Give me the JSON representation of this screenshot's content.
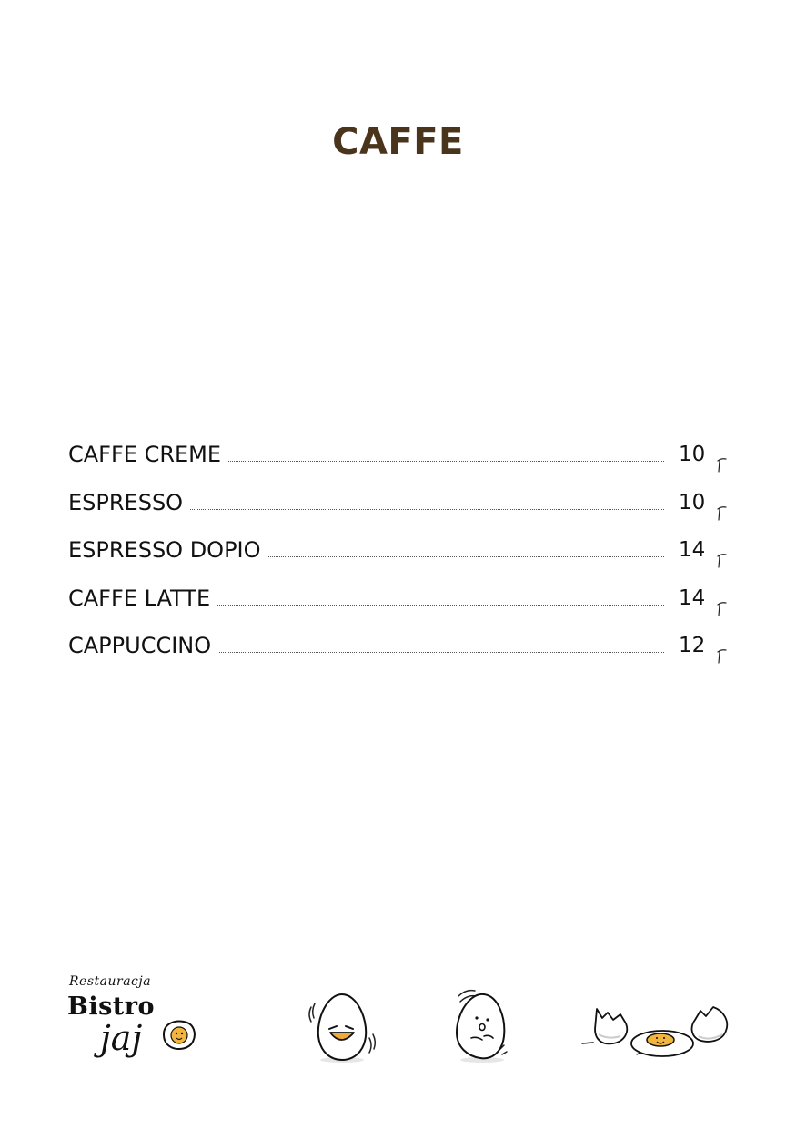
{
  "page": {
    "title": "CAFFE"
  },
  "menu": {
    "items": [
      {
        "name": "CAFFE CREME",
        "price": "10"
      },
      {
        "name": "ESPRESSO",
        "price": "10"
      },
      {
        "name": "ESPRESSO DOPIO",
        "price": "14"
      },
      {
        "name": "CAFFE LATTE",
        "price": "14"
      },
      {
        "name": "CAPPUCCINO",
        "price": "12"
      }
    ]
  },
  "footer": {
    "logo": {
      "script": "Restauracja",
      "main": "Bistro",
      "sub": "jaj"
    }
  },
  "colors": {
    "title": "#4a351c",
    "text": "#111111",
    "yolk": "#f2a93b",
    "background": "#ffffff"
  },
  "icons": [
    "currency-mark-icon",
    "bistro-jajo-logo",
    "happy-egg-icon",
    "wobbly-egg-icon",
    "broken-egg-icon"
  ]
}
